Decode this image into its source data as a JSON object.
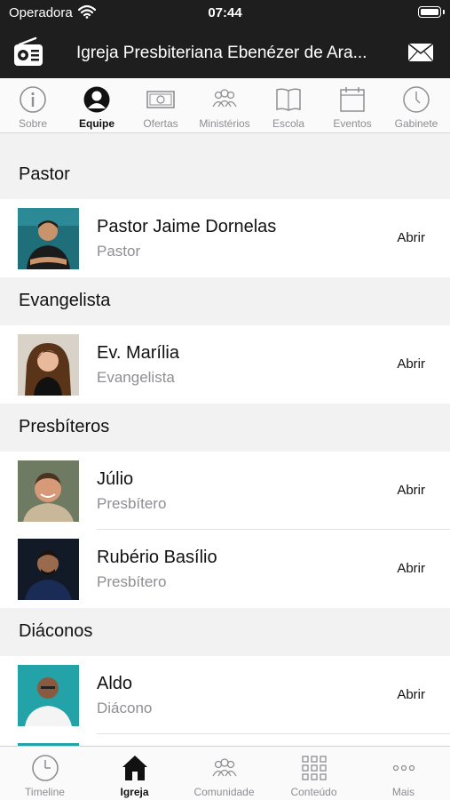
{
  "status_bar": {
    "carrier": "Operadora",
    "time": "07:44"
  },
  "header": {
    "title": "Igreja Presbiteriana Ebenézer de Ara..."
  },
  "top_tabs": [
    {
      "label": "Sobre",
      "icon": "info-icon",
      "active": false
    },
    {
      "label": "Equipe",
      "icon": "person-icon",
      "active": true
    },
    {
      "label": "Ofertas",
      "icon": "money-icon",
      "active": false
    },
    {
      "label": "Ministérios",
      "icon": "group-icon",
      "active": false
    },
    {
      "label": "Escola",
      "icon": "book-icon",
      "active": false
    },
    {
      "label": "Eventos",
      "icon": "calendar-icon",
      "active": false
    },
    {
      "label": "Gabinete",
      "icon": "clock-icon",
      "active": false
    }
  ],
  "sections": [
    {
      "title": "Pastor",
      "members": [
        {
          "name": "Pastor Jaime Dornelas",
          "role": "Pastor",
          "action": "Abrir"
        }
      ]
    },
    {
      "title": "Evangelista",
      "members": [
        {
          "name": "Ev. Marília",
          "role": "Evangelista",
          "action": "Abrir"
        }
      ]
    },
    {
      "title": "Presbíteros",
      "members": [
        {
          "name": "Júlio",
          "role": "Presbítero",
          "action": "Abrir"
        },
        {
          "name": "Rubério Basílio",
          "role": "Presbítero",
          "action": "Abrir"
        }
      ]
    },
    {
      "title": "Diáconos",
      "members": [
        {
          "name": "Aldo",
          "role": "Diácono",
          "action": "Abrir"
        }
      ]
    }
  ],
  "bottom_tabs": [
    {
      "label": "Timeline",
      "icon": "clock-icon",
      "active": false
    },
    {
      "label": "Igreja",
      "icon": "church-icon",
      "active": true
    },
    {
      "label": "Comunidade",
      "icon": "community-icon",
      "active": false
    },
    {
      "label": "Conteúdo",
      "icon": "grid-icon",
      "active": false
    },
    {
      "label": "Mais",
      "icon": "more-icon",
      "active": false
    }
  ],
  "colors": {
    "bar_dark": "#1e1e1e",
    "secondary_text": "#8e8e93",
    "background": "#f2f2f2"
  }
}
